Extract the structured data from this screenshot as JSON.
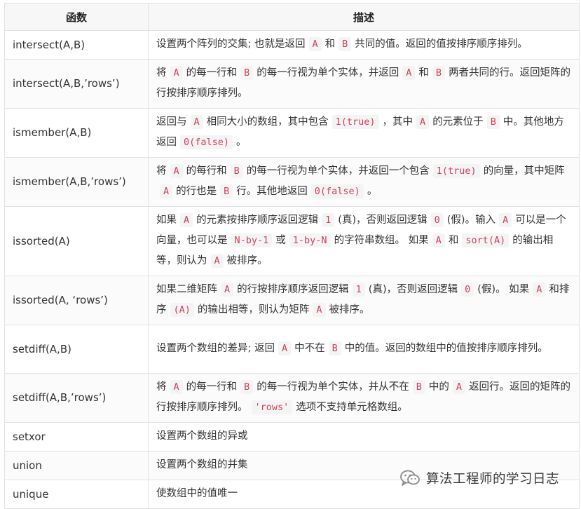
{
  "table": {
    "headers": {
      "func": "函数",
      "desc": "描述"
    },
    "rows": [
      {
        "func": "intersect(A,B)",
        "height": 39,
        "segs": [
          {
            "t": "设置两个阵列的交集; 也就是返回"
          },
          {
            "c": "A"
          },
          {
            "t": "和"
          },
          {
            "c": "B"
          },
          {
            "t": "共同的值。返回的值按排序顺序排列。"
          }
        ]
      },
      {
        "func": "intersect(A,B,’rows’)",
        "height": 69,
        "segs": [
          {
            "t": "将"
          },
          {
            "c": "A"
          },
          {
            "t": "的每一行和"
          },
          {
            "c": "B"
          },
          {
            "t": "的每一行视为单个实体，并返回"
          },
          {
            "c": "A"
          },
          {
            "t": "和"
          },
          {
            "c": "B"
          },
          {
            "t": "两者共同的行。返回矩阵的行按排序顺序排列。"
          }
        ]
      },
      {
        "func": "ismember(A,B)",
        "height": 69,
        "segs": [
          {
            "t": "返回与"
          },
          {
            "c": "A"
          },
          {
            "t": "相同大小的数组，其中包含"
          },
          {
            "c": "1(true)"
          },
          {
            "t": "，其中"
          },
          {
            "c": "A"
          },
          {
            "t": "的元素位于"
          },
          {
            "c": "B"
          },
          {
            "t": "中。其他地方返回"
          },
          {
            "c": "0(false)"
          },
          {
            "t": "。"
          }
        ]
      },
      {
        "func": "ismember(A,B,’rows’)",
        "height": 69,
        "segs": [
          {
            "t": "将"
          },
          {
            "c": "A"
          },
          {
            "t": "的每行和"
          },
          {
            "c": "B"
          },
          {
            "t": "的每一行视为单个实体，并返回一个包含"
          },
          {
            "c": "1(true)"
          },
          {
            "t": "的向量，其中矩阵"
          },
          {
            "c": "A"
          },
          {
            "t": "的行也是"
          },
          {
            "c": "B"
          },
          {
            "t": "行。其他地返回"
          },
          {
            "c": "0(false)"
          },
          {
            "t": "。"
          }
        ]
      },
      {
        "func": "issorted(A)",
        "height": 98,
        "segs": [
          {
            "t": "如果"
          },
          {
            "c": "A"
          },
          {
            "t": "的元素按排序顺序返回逻辑"
          },
          {
            "c": "1"
          },
          {
            "t": "(真)，否则返回逻辑"
          },
          {
            "c": "0"
          },
          {
            "t": "(假)。输入"
          },
          {
            "c": "A"
          },
          {
            "t": "可以是一个向量，也可以是"
          },
          {
            "c": "N-by-1"
          },
          {
            "t": "或"
          },
          {
            "c": "1-by-N"
          },
          {
            "t": "的字符串数组。 如果"
          },
          {
            "c": "A"
          },
          {
            "t": "和"
          },
          {
            "c": "sort(A)"
          },
          {
            "t": "的输出相等，则认为"
          },
          {
            "c": "A"
          },
          {
            "t": "被排序。"
          }
        ]
      },
      {
        "func": "issorted(A, ‘rows’)",
        "height": 69,
        "segs": [
          {
            "t": "如果二维矩阵"
          },
          {
            "c": "A"
          },
          {
            "t": "的行按排序顺序返回逻辑"
          },
          {
            "c": "1"
          },
          {
            "t": "(真)，否则返回逻辑"
          },
          {
            "c": "0"
          },
          {
            "t": "(假)。 如果"
          },
          {
            "c": "A"
          },
          {
            "t": "和排序"
          },
          {
            "c": "(A)"
          },
          {
            "t": "的输出相等，则认为矩阵"
          },
          {
            "c": "A"
          },
          {
            "t": "被排序。"
          }
        ]
      },
      {
        "func": "setdiff(A,B)",
        "height": 69,
        "segs": [
          {
            "t": "设置两个数组的差异; 返回"
          },
          {
            "c": "A"
          },
          {
            "t": "中不在"
          },
          {
            "c": "B"
          },
          {
            "t": "中的值。返回的数组中的值按排序顺序排列。"
          }
        ]
      },
      {
        "func": "setdiff(A,B,’rows’)",
        "height": 69,
        "segs": [
          {
            "t": "将"
          },
          {
            "c": "A"
          },
          {
            "t": "的每一行和"
          },
          {
            "c": "B"
          },
          {
            "t": "的每一行视为单个实体，并从不在"
          },
          {
            "c": "B"
          },
          {
            "t": "中的"
          },
          {
            "c": "A"
          },
          {
            "t": "返回行。返回的矩阵的行按排序顺序排列。"
          },
          {
            "c": "'rows'"
          },
          {
            "t": "选项不支持单元格数组。"
          }
        ]
      },
      {
        "func": "setxor",
        "height": 39,
        "segs": [
          {
            "t": "设置两个数组的异或"
          }
        ]
      },
      {
        "func": "union",
        "height": 39,
        "segs": [
          {
            "t": "设置两个数组的并集"
          }
        ]
      },
      {
        "func": "unique",
        "height": 39,
        "segs": [
          {
            "t": "使数组中的值唯一"
          }
        ]
      }
    ]
  },
  "watermark": {
    "icon": "wechat-icon",
    "text": "算法工程师的学习日志",
    "color": "#3b3b3b"
  },
  "colors": {
    "code_text": "#d43f5a",
    "code_bg": "#f3f4f4",
    "border": "#dfe2e5",
    "header_bg": "#f7f7f7"
  }
}
